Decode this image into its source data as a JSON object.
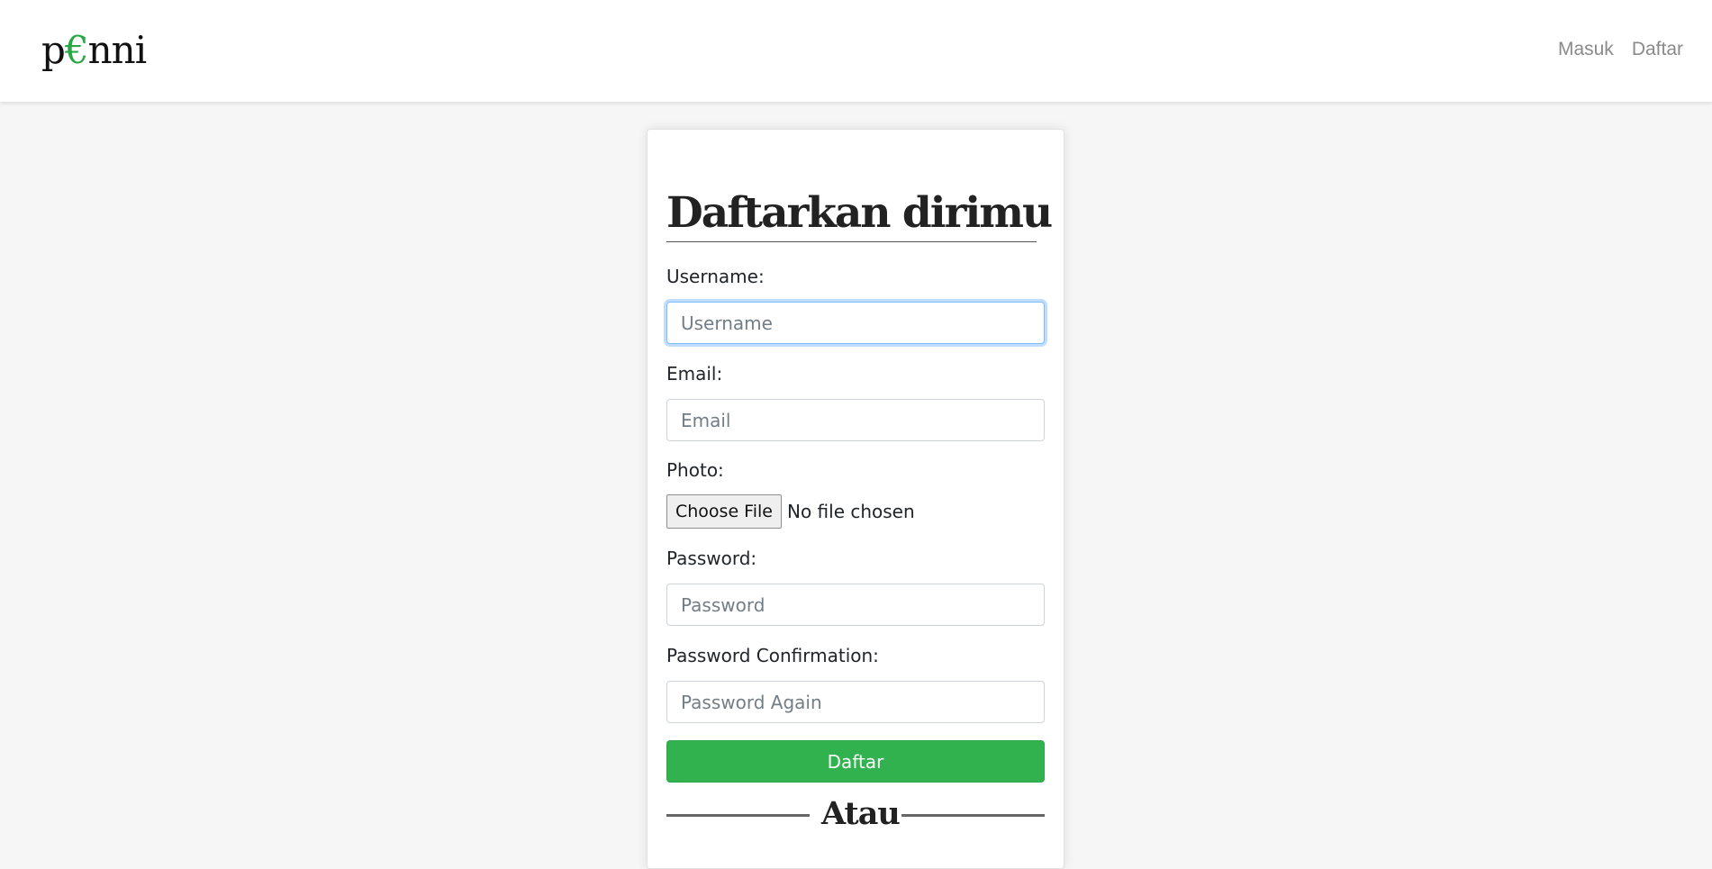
{
  "brand": {
    "prefix": "p",
    "accent": "€",
    "suffix": "nni",
    "accent_color": "#28a745"
  },
  "nav": {
    "login": "Masuk",
    "register": "Daftar"
  },
  "form": {
    "title": "Daftarkan dirimu",
    "username": {
      "label": "Username:",
      "placeholder": "Username",
      "value": ""
    },
    "email": {
      "label": "Email:",
      "placeholder": "Email",
      "value": ""
    },
    "photo": {
      "label": "Photo:",
      "button": "Choose File",
      "status": "No file chosen"
    },
    "password": {
      "label": "Password:",
      "placeholder": "Password",
      "value": ""
    },
    "password_confirmation": {
      "label": "Password Confirmation:",
      "placeholder": "Password Again",
      "value": ""
    },
    "submit": "Daftar",
    "divider": "Atau"
  },
  "colors": {
    "submit_bg": "#31b24f",
    "page_bg": "#f6f6f6",
    "focus_border": "#80bdff"
  }
}
